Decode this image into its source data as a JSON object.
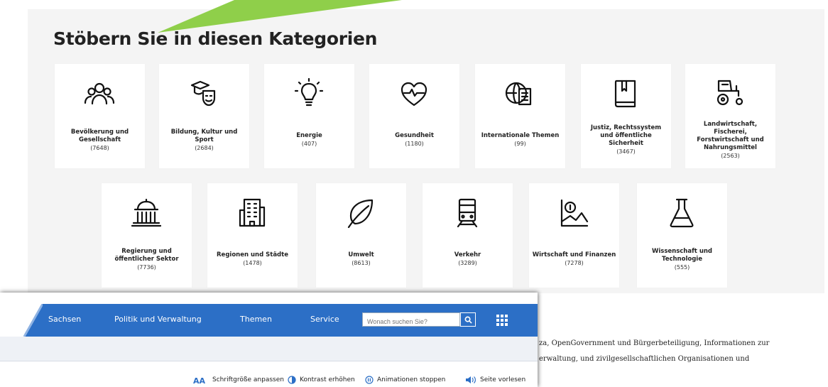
{
  "title": "Stöbern Sie in diesen Kategorien",
  "colors": {
    "nav_blue": "#2c6fc6",
    "pointer_green": "#8fcf4a",
    "panel_bg": "#f4f4f4"
  },
  "categories": [
    {
      "icon": "people-icon",
      "name": "Bevölkerung und Gesellschaft",
      "count": "(7648)"
    },
    {
      "icon": "graduation-masks-icon",
      "name": "Bildung, Kultur und Sport",
      "count": "(2684)"
    },
    {
      "icon": "lightbulb-icon",
      "name": "Energie",
      "count": "(407)"
    },
    {
      "icon": "heart-pulse-icon",
      "name": "Gesundheit",
      "count": "(1180)"
    },
    {
      "icon": "globe-document-icon",
      "name": "Internationale Themen",
      "count": "(99)"
    },
    {
      "icon": "law-book-icon",
      "name": "Justiz, Rechtssystem und öffentliche Sicherheit",
      "count": "(3467)"
    },
    {
      "icon": "tractor-icon",
      "name": "Landwirtschaft, Fischerei, Forstwirtschaft und Nahrungsmittel",
      "count": "(2563)"
    },
    {
      "icon": "government-building-icon",
      "name": "Regierung und öffentlicher Sektor",
      "count": "(7736)"
    },
    {
      "icon": "office-building-icon",
      "name": "Regionen und Städte",
      "count": "(1478)"
    },
    {
      "icon": "leaf-icon",
      "name": "Umwelt",
      "count": "(8613)"
    },
    {
      "icon": "train-icon",
      "name": "Verkehr",
      "count": "(3289)"
    },
    {
      "icon": "finance-chart-icon",
      "name": "Wirtschaft und Finanzen",
      "count": "(7278)"
    },
    {
      "icon": "lab-flask-icon",
      "name": "Wissenschaft und Technologie",
      "count": "(555)"
    }
  ],
  "nav": {
    "items": [
      "Sachsen",
      "Politik und Verwaltung",
      "Themen",
      "Service"
    ],
    "search_placeholder": "Wonach suchen Sie?",
    "search_icon": "search-icon",
    "grid_icon": "grid-icon"
  },
  "accessibility": [
    {
      "icon": "font-size-icon",
      "label": "Schriftgröße anpassen"
    },
    {
      "icon": "contrast-icon",
      "label": "Kontrast erhöhen"
    },
    {
      "icon": "pause-icon",
      "label": "Animationen stoppen"
    },
    {
      "icon": "speaker-icon",
      "label": "Seite vorlesen"
    }
  ],
  "side_text": [
    "za, OpenGovernment und Bürgerbeteiligung, Informationen zur",
    "erwaltung, und zivilgesellschaftlichen Organisationen und"
  ]
}
